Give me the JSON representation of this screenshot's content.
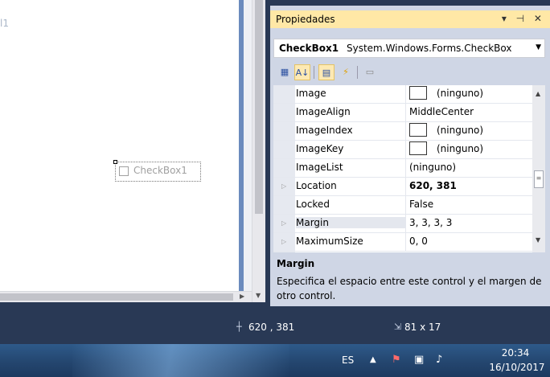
{
  "designer": {
    "form_title_fragment": "l1",
    "checkbox_label": "CheckBox1"
  },
  "properties": {
    "title": "Propiedades",
    "title_buttons": "▾ ⊣ ✕",
    "selected_object": "CheckBox1",
    "selected_type": "System.Windows.Forms.CheckBox",
    "toolbar": [
      {
        "icon": "categorized-icon",
        "glyph": "▦"
      },
      {
        "icon": "alphabetical-icon",
        "glyph": "A↓"
      },
      {
        "icon": "properties-icon",
        "glyph": "▤"
      },
      {
        "icon": "events-icon",
        "glyph": "⚡"
      },
      {
        "icon": "property-pages-icon",
        "glyph": "▭"
      }
    ],
    "rows": [
      {
        "name": "Image",
        "value": "(ninguno)",
        "swatch": true,
        "expandable": false,
        "bold": false
      },
      {
        "name": "ImageAlign",
        "value": "MiddleCenter",
        "swatch": false,
        "expandable": false,
        "bold": false
      },
      {
        "name": "ImageIndex",
        "value": "(ninguno)",
        "swatch": true,
        "expandable": false,
        "bold": false
      },
      {
        "name": "ImageKey",
        "value": "(ninguno)",
        "swatch": true,
        "expandable": false,
        "bold": false
      },
      {
        "name": "ImageList",
        "value": "(ninguno)",
        "swatch": false,
        "expandable": false,
        "bold": false
      },
      {
        "name": "Location",
        "value": "620, 381",
        "swatch": false,
        "expandable": true,
        "bold": true
      },
      {
        "name": "Locked",
        "value": "False",
        "swatch": false,
        "expandable": false,
        "bold": false
      },
      {
        "name": "Margin",
        "value": "3, 3, 3, 3",
        "swatch": false,
        "expandable": true,
        "bold": false,
        "selected": true
      },
      {
        "name": "MaximumSize",
        "value": "0, 0",
        "swatch": false,
        "expandable": true,
        "bold": false
      }
    ],
    "description_title": "Margin",
    "description_text": "Especifica el espacio entre este control y el margen de otro control."
  },
  "statusbar": {
    "position": "620 , 381",
    "size": "81 x 17"
  },
  "taskbar": {
    "language": "ES",
    "time": "20:34",
    "date": "16/10/2017"
  },
  "colors": {
    "ide_background": "#293955",
    "props_title_active": "#ffe8a6",
    "props_panel": "#cfd6e5"
  }
}
